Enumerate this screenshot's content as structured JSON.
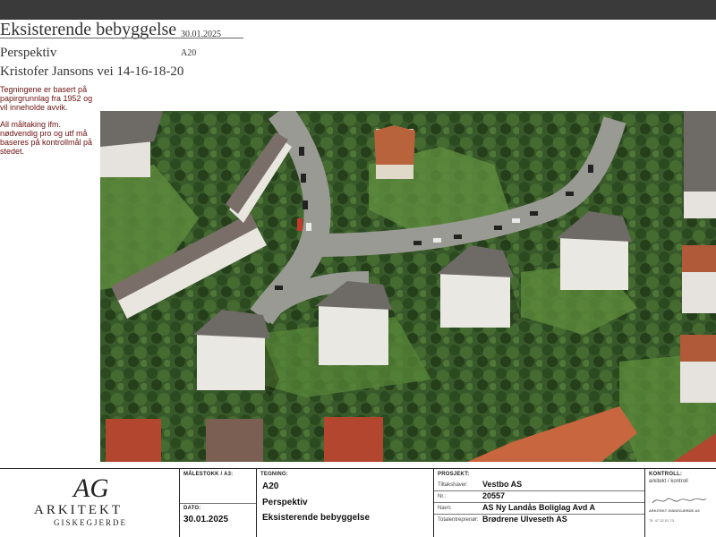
{
  "header": {
    "title": "Eksisterende bebyggelse",
    "date": "30.01.2025",
    "subtitle": "Perspektiv",
    "code": "A20",
    "address": "Kristofer Jansons vei 14-16-18-20"
  },
  "notes": {
    "basis": "Tegningene er basert på papirgrunnlag fra 1952 og vil inneholde avvik.",
    "measuring": "All måltaking ifm. nødvendig pro og utf må baseres på kontrollmål på stedet."
  },
  "title_block": {
    "logo": {
      "monogram": "AG",
      "name": "ARKITEKT",
      "subname": "GISKEGJERDE"
    },
    "scale_header": "MÅLESTOKK / A3:",
    "date_label": "DATO:",
    "date_value": "30.01.2025",
    "drawing_header": "TEGNING:",
    "drawing_code": "A20",
    "drawing_type": "Perspektiv",
    "drawing_title": "Eksisterende bebyggelse",
    "project_header": "PROSJEKT:",
    "client_label": "Tiltakshaver:",
    "client_value": "Vestbo AS",
    "number_label": "Nr.:",
    "number_value": "20557",
    "name_label": "Navn:",
    "name_value": "AS Ny Landås Boliglag Avd A",
    "contractor_label": "Totalentreprenør:",
    "contractor_value": "Brødrene Ulveseth AS",
    "control_header": "KONTROLL:",
    "control_roles": "arkitekt   / kontroll",
    "firm_name": "ARKITEKT GISKEGJERDE AS",
    "firm_tel": "Tlf. 47 32 51 73"
  },
  "colors": {
    "note_text": "#6b1010",
    "grass": "#4f7a34",
    "trees": "#2f4d22",
    "road": "#9a9a94",
    "roof_grey": "#6e6a66",
    "roof_tile": "#b05a3a"
  }
}
